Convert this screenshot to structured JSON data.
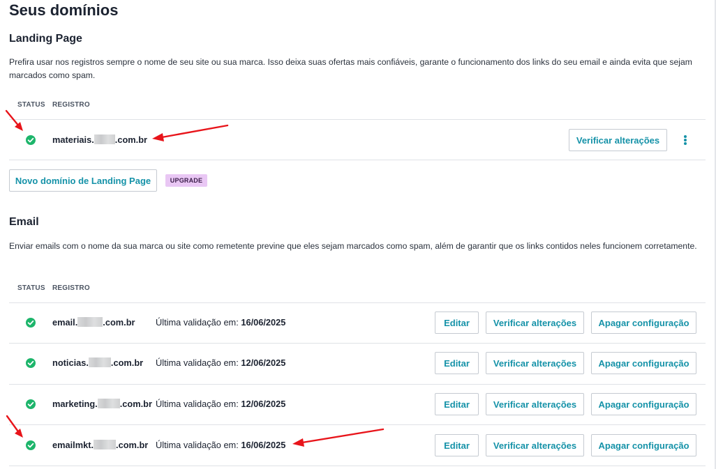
{
  "page": {
    "title": "Seus domínios"
  },
  "landing": {
    "title": "Landing Page",
    "description": "Prefira usar nos registros sempre o nome de seu site ou sua marca. Isso deixa suas ofertas mais confiáveis, garante o funcionamento dos links do seu email e ainda evita que sejam marcados como spam.",
    "columns": {
      "status": "STATUS",
      "registro": "REGISTRO"
    },
    "row": {
      "domain_prefix": "materiais.",
      "domain_suffix": ".com.br",
      "verify_label": "Verificar alterações",
      "status_icon": "check-circle-icon"
    },
    "new_domain_label": "Novo domínio de Landing Page",
    "upgrade_badge": "UPGRADE"
  },
  "email": {
    "title": "Email",
    "description": "Enviar emails com o nome da sua marca ou site como remetente previne que eles sejam marcados como spam, além de garantir que os links contidos neles funcionem corretamente.",
    "columns": {
      "status": "STATUS",
      "registro": "REGISTRO"
    },
    "validation_label": "Última validação em:",
    "edit_label": "Editar",
    "verify_label": "Verificar alterações",
    "delete_label": "Apagar configuração",
    "rows": [
      {
        "domain_prefix": "email.",
        "domain_suffix": ".com.br",
        "validated_on": "16/06/2025"
      },
      {
        "domain_prefix": "noticias.",
        "domain_suffix": ".com.br",
        "validated_on": "12/06/2025"
      },
      {
        "domain_prefix": "marketing.",
        "domain_suffix": ".com.br",
        "validated_on": "12/06/2025"
      },
      {
        "domain_prefix": "emailmkt.",
        "domain_suffix": ".com.br",
        "validated_on": "16/06/2025"
      }
    ]
  },
  "colors": {
    "accent": "#1592a8",
    "success": "#1db56b",
    "annotation_arrow": "#e8141a",
    "upgrade_badge": "#e9c7f4"
  }
}
